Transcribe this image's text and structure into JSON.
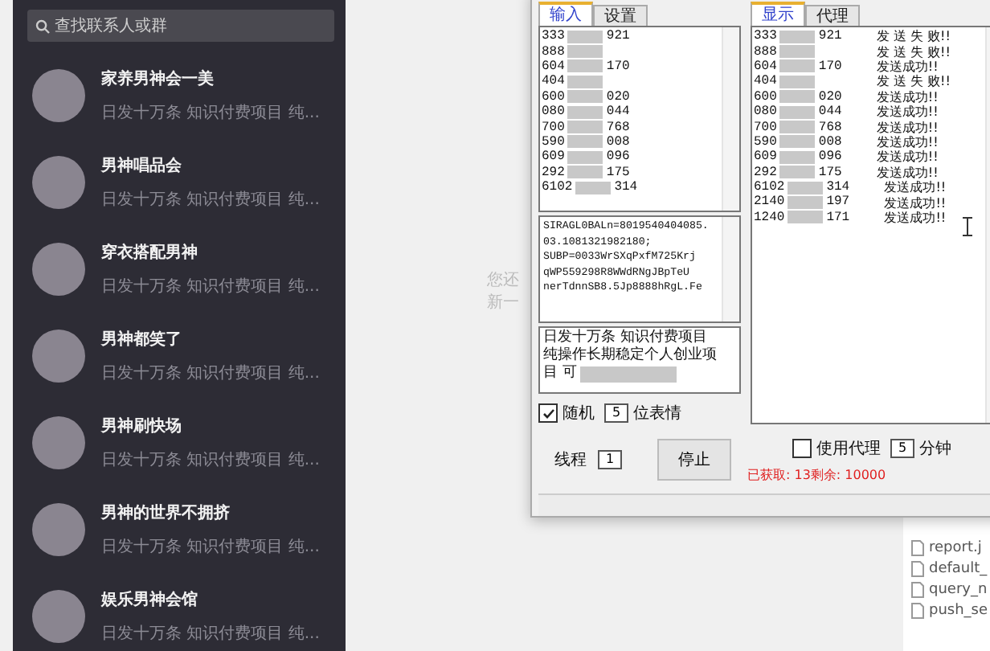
{
  "sidebar": {
    "search": {
      "placeholder": "查找联系人或群"
    },
    "chats": [
      {
        "name": "家养男神会一美",
        "preview": "日发十万条 知识付费项目 纯..."
      },
      {
        "name": "男神唱品会",
        "preview": "日发十万条 知识付费项目 纯..."
      },
      {
        "name": "穿衣搭配男神",
        "preview": "日发十万条 知识付费项目 纯..."
      },
      {
        "name": "男神都笑了",
        "preview": "日发十万条 知识付费项目 纯..."
      },
      {
        "name": "男神刷快场",
        "preview": "日发十万条 知识付费项目 纯..."
      },
      {
        "name": "男神的世界不拥挤",
        "preview": "日发十万条 知识付费项目 纯..."
      },
      {
        "name": "娱乐男神会馆",
        "preview": "日发十万条 知识付费项目 纯..."
      }
    ]
  },
  "background_text": [
    "您还",
    "新一"
  ],
  "tool": {
    "left_tabs": [
      {
        "label": "输入",
        "selected": true
      },
      {
        "label": "设置",
        "selected": false
      }
    ],
    "input_lines": [
      {
        "head": "333",
        "tail": "921"
      },
      {
        "head": "888"
      },
      {
        "head": "604",
        "tail": "170"
      },
      {
        "head": "404"
      },
      {
        "head": "600",
        "tail": "020"
      },
      {
        "head": "080",
        "tail": "044"
      },
      {
        "head": "700",
        "tail": "768"
      },
      {
        "head": "590",
        "tail": "008"
      },
      {
        "head": "609",
        "tail": "096"
      },
      {
        "head": "292",
        "tail": "175"
      },
      {
        "head": "6102",
        "tail": "314"
      }
    ],
    "cookie_lines": [
      "SIRAGL0BALn=8019540404085.",
      "03.1081321982180;",
      "SUBP=0033WrSXqPxfM725Krj",
      "qWP559298R8WWdRNgJBpTeU",
      "nerTdnnSB8.5Jp8888hRgL.Fe"
    ],
    "message_lines": [
      "日发十万条 知识付费项目",
      "纯操作长期稳定个人创业项",
      "目 可"
    ],
    "random": {
      "label": "随机",
      "checked": true,
      "value": "5",
      "suffix": "位表情"
    },
    "threads": {
      "label": "线程",
      "value": "1"
    },
    "stop_button": "停止",
    "right_tabs": [
      {
        "label": "显示",
        "selected": true
      },
      {
        "label": "代理",
        "selected": false
      }
    ],
    "output_lines": [
      {
        "head": "333",
        "tail": "921",
        "status": "发 送 失 败!!"
      },
      {
        "head": "888",
        "status": "发 送 失 败!!"
      },
      {
        "head": "604",
        "tail": "170",
        "status": "发送成功!!"
      },
      {
        "head": "404",
        "status": "发 送 失 败!!"
      },
      {
        "head": "600",
        "tail": "020",
        "status": "发送成功!!"
      },
      {
        "head": "080",
        "tail": "044",
        "status": "发送成功!!"
      },
      {
        "head": "700",
        "tail": "768",
        "status": "发送成功!!"
      },
      {
        "head": "590",
        "tail": "008",
        "status": "发送成功!!"
      },
      {
        "head": "609",
        "tail": "096",
        "status": "发送成功!!"
      },
      {
        "head": "292",
        "tail": "175",
        "status": "发送成功!!"
      },
      {
        "head": "6102",
        "tail": "314",
        "status": "发送成功!!"
      },
      {
        "head": "2140",
        "tail": "197",
        "status": "发送成功!!"
      },
      {
        "head": "1240",
        "tail": "171",
        "status": "发送成功!!"
      }
    ],
    "proxy": {
      "label": "使用代理",
      "checked": false,
      "value": "5",
      "suffix": "分钟"
    },
    "progress_text": "已获取: 13剩余: 10000"
  },
  "files": [
    "report.j",
    "default_",
    "query_n",
    "push_se"
  ]
}
